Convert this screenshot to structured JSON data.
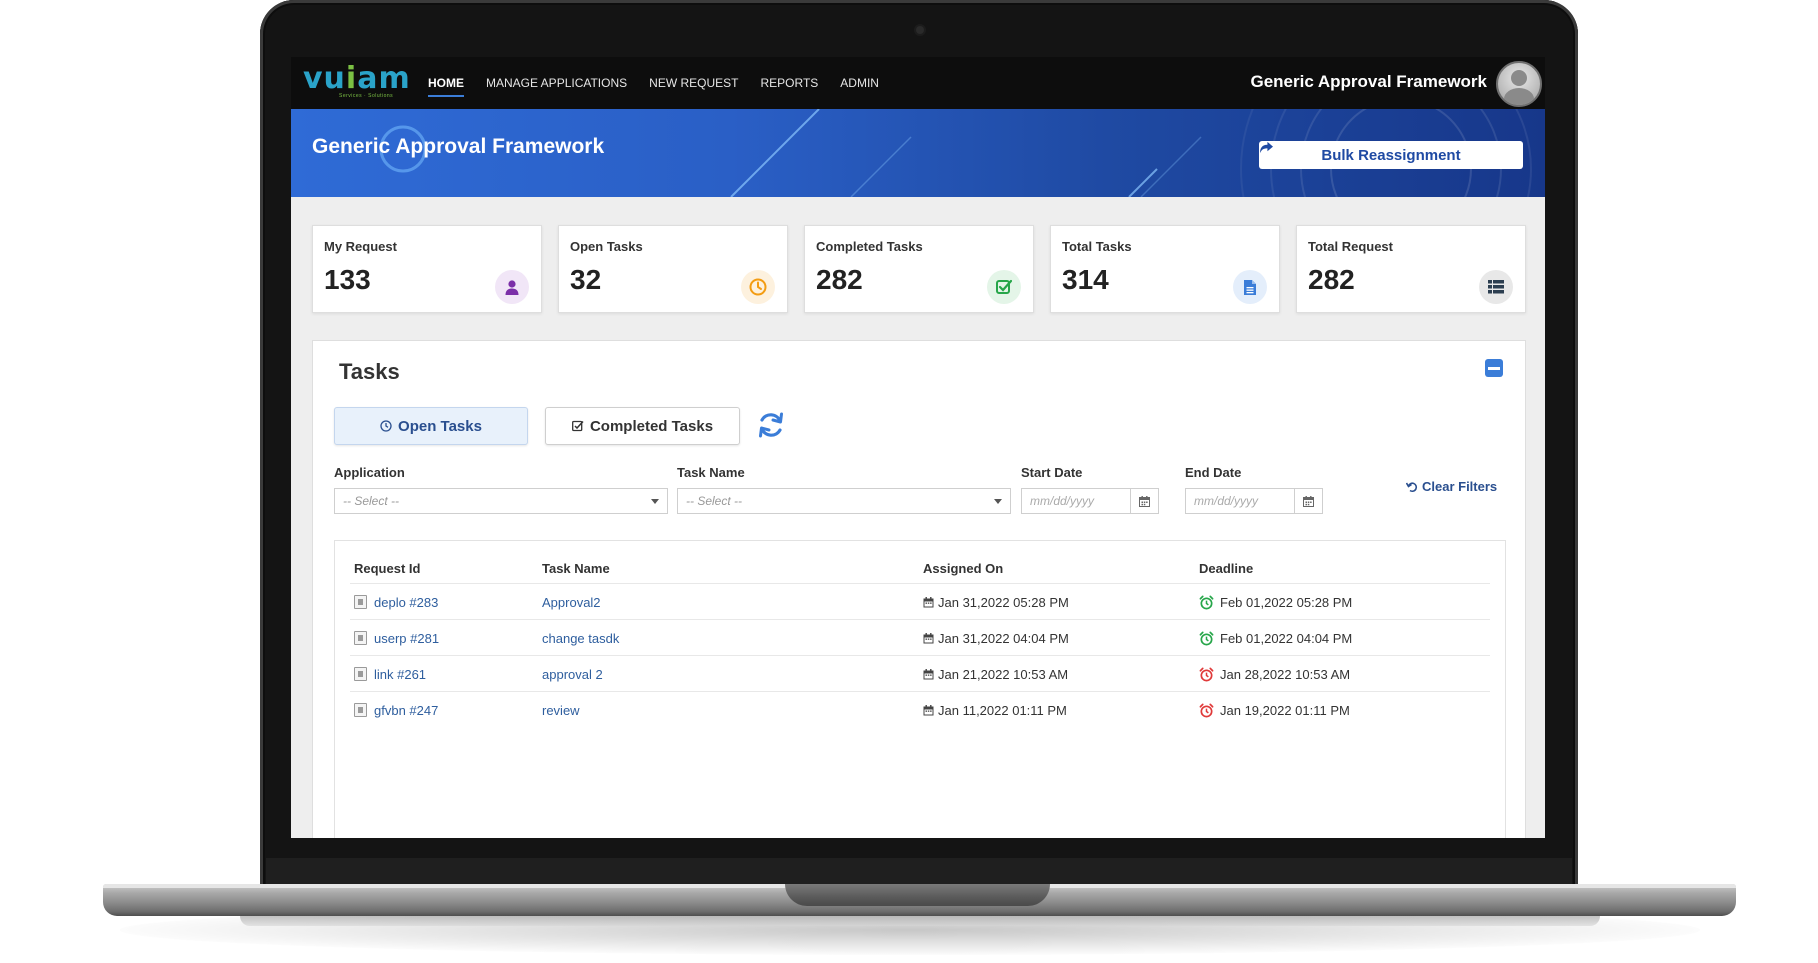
{
  "nav": {
    "logo": {
      "main": "vu",
      "accent": "i",
      "rest": "am",
      "tagline": "Services · Solutions"
    },
    "items": [
      {
        "label": "HOME",
        "active": true
      },
      {
        "label": "MANAGE APPLICATIONS",
        "active": false
      },
      {
        "label": "NEW REQUEST",
        "active": false
      },
      {
        "label": "REPORTS",
        "active": false
      },
      {
        "label": "ADMIN",
        "active": false
      }
    ],
    "app_title": "Generic Approval Framework"
  },
  "banner": {
    "title": "Generic Approval Framework",
    "bulk_button": "Bulk Reassignment"
  },
  "stats": [
    {
      "label": "My Request",
      "value": "133",
      "icon": "user-icon",
      "color": "#7b2fa8",
      "bg": "#f1e6f7"
    },
    {
      "label": "Open Tasks",
      "value": "32",
      "icon": "clock-icon",
      "color": "#f39c12",
      "bg": "#fdf1de"
    },
    {
      "label": "Completed Tasks",
      "value": "282",
      "icon": "check-square-icon",
      "color": "#27a64a",
      "bg": "#e4f5e8"
    },
    {
      "label": "Total Tasks",
      "value": "314",
      "icon": "document-icon",
      "color": "#3b7dd8",
      "bg": "#e4eefb"
    },
    {
      "label": "Total Request",
      "value": "282",
      "icon": "list-icon",
      "color": "#2c3e50",
      "bg": "#e8e8e8"
    }
  ],
  "tasks": {
    "title": "Tasks",
    "tabs": {
      "open": "Open Tasks",
      "completed": "Completed Tasks"
    },
    "filters": {
      "application_label": "Application",
      "application_value": "-- Select --",
      "task_name_label": "Task Name",
      "task_name_value": "-- Select --",
      "start_date_label": "Start Date",
      "start_date_placeholder": "mm/dd/yyyy",
      "end_date_label": "End Date",
      "end_date_placeholder": "mm/dd/yyyy",
      "clear": "Clear Filters"
    },
    "columns": {
      "request_id": "Request Id",
      "task_name": "Task Name",
      "assigned_on": "Assigned On",
      "deadline": "Deadline"
    },
    "rows": [
      {
        "request_id": "deplo #283",
        "task_name": "Approval2",
        "assigned_on": "Jan 31,2022 05:28 PM",
        "deadline": "Feb 01,2022 05:28 PM",
        "overdue": false
      },
      {
        "request_id": "userp #281",
        "task_name": "change tasdk",
        "assigned_on": "Jan 31,2022 04:04 PM",
        "deadline": "Feb 01,2022 04:04 PM",
        "overdue": false
      },
      {
        "request_id": "link #261",
        "task_name": "approval 2",
        "assigned_on": "Jan 21,2022 10:53 AM",
        "deadline": "Jan 28,2022 10:53 AM",
        "overdue": true
      },
      {
        "request_id": "gfvbn #247",
        "task_name": "review",
        "assigned_on": "Jan 11,2022 01:11 PM",
        "deadline": "Jan 19,2022 01:11 PM",
        "overdue": true
      }
    ]
  },
  "colors": {
    "accent": "#3b7dd8",
    "ok": "#27a64a",
    "late": "#e03a3a"
  }
}
